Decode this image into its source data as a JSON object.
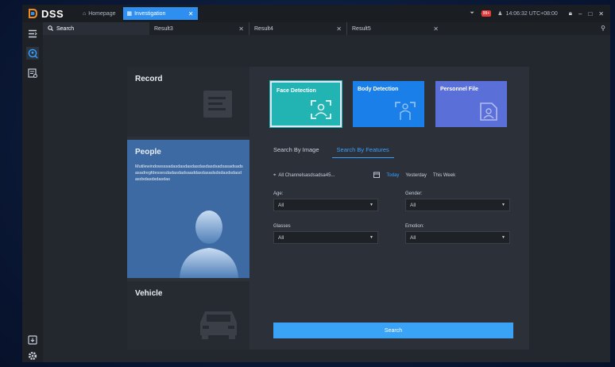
{
  "titlebar": {
    "app_name": "DSS",
    "home_tab": "Homepage",
    "active_tab": "Investigation",
    "badge": "99+",
    "clock": "14:06:32 UTC+08:00"
  },
  "tabs": {
    "search": "Search",
    "result3": "Result3",
    "result4": "Result4",
    "result5": "Result5"
  },
  "categories": {
    "record": "Record",
    "people": "People",
    "people_desc": "Mutilewindowsssadasdasdasdasdasdasdsadsasadsadsasadregfdessesdadasdadsaaddasdasadsdsdasdsdasdasdsdasdsdasdas",
    "vehicle": "Vehicle"
  },
  "tiles": {
    "face": "Face Detection",
    "body": "Body Detection",
    "personnel": "Personnel File"
  },
  "search_tabs": {
    "by_image": "Search By Image",
    "by_features": "Search By Features"
  },
  "filters": {
    "channels": "All Channelsasdsadsa45...",
    "today": "Today",
    "yesterday": "Yesterday",
    "this_week": "This Week"
  },
  "fields": {
    "age_label": "Age:",
    "age_value": "All",
    "gender_label": "Gender:",
    "gender_value": "All",
    "glasses_label": "Glasses",
    "glasses_value": "All",
    "emotion_label": "Emotion:",
    "emotion_value": "All"
  },
  "search_button": "Search",
  "colors": {
    "accent": "#2f8ff0",
    "face_tile": "#22b3b3",
    "body_tile": "#1a7fe8",
    "personnel_tile": "#5a6fd8",
    "people_card": "#3d6aa3",
    "search_button": "#3aa3f5"
  }
}
